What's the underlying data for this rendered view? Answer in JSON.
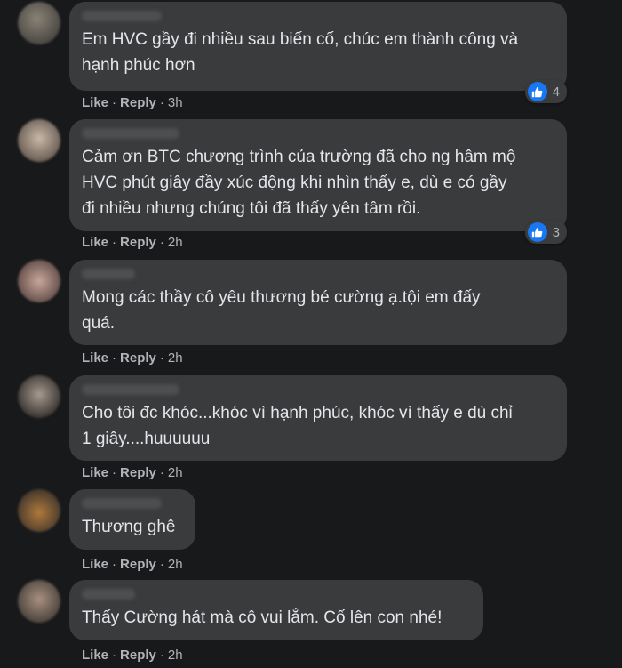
{
  "comments": [
    {
      "text": "Em HVC gầy đi nhiều sau biến cố, chúc em thành công và\nhạnh phúc hơn",
      "like": "Like",
      "reply": "Reply",
      "time": "3h",
      "reactions": "4"
    },
    {
      "text": "Cảm ơn BTC chương trình của trường đã cho ng hâm mộ\nHVC phút giây đầy xúc động khi nhìn thấy e, dù e có gầy\nđi nhiều nhưng chúng tôi đã thấy yên tâm rồi.",
      "like": "Like",
      "reply": "Reply",
      "time": "2h",
      "reactions": "3"
    },
    {
      "text": "Mong các thầy cô yêu thương bé cường ạ.tội em đấy\nquá.",
      "like": "Like",
      "reply": "Reply",
      "time": "2h"
    },
    {
      "text": "Cho tôi đc khóc...khóc vì hạnh phúc, khóc vì thấy e dù chỉ\n1 giây....huuuuuu",
      "like": "Like",
      "reply": "Reply",
      "time": "2h"
    },
    {
      "text": "Thương ghê",
      "like": "Like",
      "reply": "Reply",
      "time": "2h"
    },
    {
      "text": "Thấy Cường hát mà cô vui lắm. Cố lên con nhé!",
      "like": "Like",
      "reply": "Reply",
      "time": "2h"
    }
  ],
  "separator": "·",
  "icons": {
    "reaction": "like-thumb-icon",
    "reaction_color": "#1877f2"
  },
  "colors": {
    "background": "#18191a",
    "bubble": "#3a3b3c",
    "text": "#e4e6eb",
    "meta": "#b0b3b8"
  }
}
